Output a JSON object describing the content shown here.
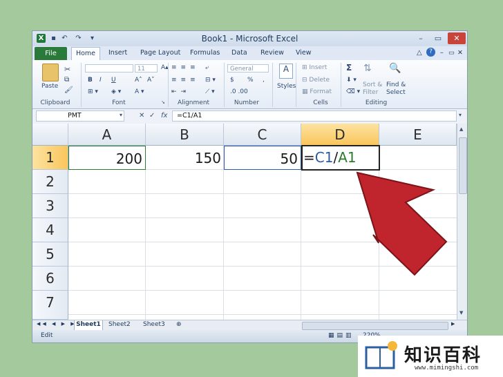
{
  "window": {
    "title": "Book1 - Microsoft Excel",
    "controls": {
      "minimize": "–",
      "restore": "▭",
      "close": "✕"
    }
  },
  "quick_access": {
    "logo": "X",
    "save": "▪",
    "undo": "↶",
    "redo": "↷",
    "customize": "▾"
  },
  "tabs": [
    "File",
    "Home",
    "Insert",
    "Page Layout",
    "Formulas",
    "Data",
    "Review",
    "View"
  ],
  "ribbon": {
    "clipboard": {
      "paste": "Paste",
      "label": "Clipboard"
    },
    "font": {
      "name": "",
      "size": "11",
      "bold": "B",
      "italic": "I",
      "underline": "U",
      "label": "Font"
    },
    "alignment": {
      "label": "Alignment"
    },
    "number": {
      "format": "General",
      "currency": "$",
      "percent": "%",
      "comma": ",",
      "label": "Number"
    },
    "styles": {
      "label": "Styles"
    },
    "cells": {
      "insert": "Insert",
      "delete": "Delete",
      "format": "Format",
      "label": "Cells"
    },
    "editing": {
      "sort": "Sort &",
      "filter": "Filter",
      "find": "Find &",
      "select": "Select",
      "label": "Editing",
      "sum": "Σ"
    }
  },
  "formula_bar": {
    "name_box": "PMT",
    "fx": "fx",
    "cancel": "✕",
    "enter": "✓",
    "formula": "=C1/A1"
  },
  "columns": [
    "A",
    "B",
    "C",
    "D",
    "E"
  ],
  "rows": [
    "1",
    "2",
    "3",
    "4",
    "5",
    "6",
    "7"
  ],
  "cells": {
    "A1": "200",
    "B1": "150",
    "C1": "50"
  },
  "editing_cell": {
    "eq": "=",
    "ref1": "C1",
    "slash": "/",
    "ref2": "A1",
    "ref1_color": "#2a5aa8",
    "ref2_color": "#2c7a2c"
  },
  "sheets": [
    "Sheet1",
    "Sheet2",
    "Sheet3"
  ],
  "status": {
    "mode": "Edit",
    "zoom": "220%"
  },
  "watermark": {
    "text": "知识百科",
    "url": "www.mimingshi.com"
  },
  "colors": {
    "background": "#a3c99c",
    "file_tab": "#2a7a3b",
    "selected_header": "#f9c65c",
    "arrow": "#c0242c"
  }
}
